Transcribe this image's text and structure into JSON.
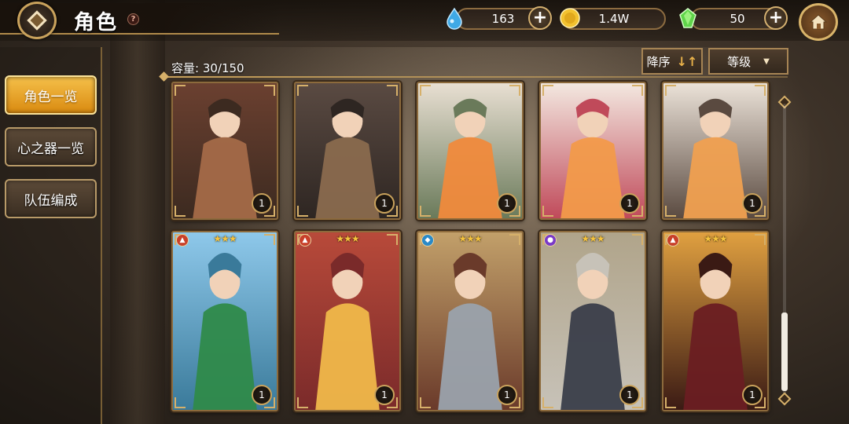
{
  "header": {
    "title": "角色",
    "help_symbol": "?",
    "back_icon": "diamond-back-icon",
    "home_icon": "home-icon"
  },
  "currencies": [
    {
      "name": "water-drop-icon",
      "value": "163",
      "color": "#3fa9e6"
    },
    {
      "name": "gold-coin-icon",
      "value": "1.4W",
      "color": "#f2c230"
    },
    {
      "name": "green-gem-icon",
      "value": "50",
      "color": "#5fd44a"
    }
  ],
  "sidebar": {
    "items": [
      {
        "label": "角色一览",
        "active": true
      },
      {
        "label": "心之器一览",
        "active": false
      },
      {
        "label": "队伍编成",
        "active": false
      }
    ]
  },
  "toolbar": {
    "capacity": "容量: 30/150",
    "sort_order": "降序",
    "sort_icon": "↓↑",
    "sort_field": "等级"
  },
  "cards": [
    {
      "level": "1",
      "stars": "",
      "element": "",
      "palette": [
        "#6b4030",
        "#a46a48",
        "#3c2a20"
      ]
    },
    {
      "level": "1",
      "stars": "",
      "element": "",
      "palette": [
        "#5a4a42",
        "#8a6a4e",
        "#2e2622"
      ]
    },
    {
      "level": "1",
      "stars": "",
      "element": "",
      "palette": [
        "#e8dfd2",
        "#f08a3c",
        "#6a7a5a"
      ]
    },
    {
      "level": "1",
      "stars": "",
      "element": "",
      "palette": [
        "#f3e8e0",
        "#f29a4a",
        "#c04a5a"
      ]
    },
    {
      "level": "1",
      "stars": "",
      "element": "",
      "palette": [
        "#ebe2d8",
        "#f0a050",
        "#5a4a40"
      ]
    },
    {
      "level": "1",
      "stars": "★★★",
      "element": "fire-element-icon",
      "palette": [
        "#8ec8ea",
        "#2f8a4a",
        "#3a7a9a"
      ]
    },
    {
      "level": "1",
      "stars": "★★★",
      "element": "fire-element-icon",
      "palette": [
        "#b84a3a",
        "#f0b84a",
        "#7a2a2a"
      ]
    },
    {
      "level": "1",
      "stars": "★★★",
      "element": "water-element-icon",
      "palette": [
        "#c2a06a",
        "#9aa2ac",
        "#6a3a2a"
      ]
    },
    {
      "level": "1",
      "stars": "★★★",
      "element": "dark-element-icon",
      "palette": [
        "#b0a48a",
        "#3a3e4a",
        "#c7c2b8"
      ]
    },
    {
      "level": "1",
      "stars": "★★★",
      "element": "fire-element-icon",
      "palette": [
        "#e0a040",
        "#6a1e22",
        "#3a1a14"
      ]
    }
  ]
}
